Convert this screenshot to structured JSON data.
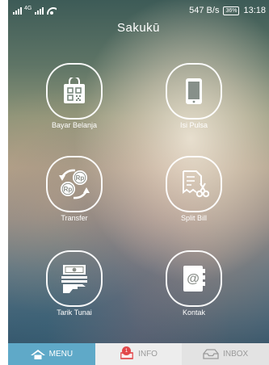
{
  "status_bar": {
    "network_1": "4G",
    "speed": "547 B/s",
    "battery": "36%",
    "time": "13:18"
  },
  "app": {
    "title": "Sakukū"
  },
  "menu": {
    "items": [
      {
        "label": "Bayar Belanja",
        "icon": "shopping-bag-qr-icon"
      },
      {
        "label": "Isi Pulsa",
        "icon": "mobile-phone-icon"
      },
      {
        "label": "Transfer",
        "icon": "money-transfer-icon"
      },
      {
        "label": "Split Bill",
        "icon": "split-bill-scissors-icon"
      },
      {
        "label": "Tarik Tunai",
        "icon": "cash-withdrawal-icon"
      },
      {
        "label": "Kontak",
        "icon": "address-book-icon"
      }
    ]
  },
  "tabs": [
    {
      "label": "MENU",
      "icon": "home-icon",
      "active": true
    },
    {
      "label": "INFO",
      "icon": "info-icon",
      "badge": "1"
    },
    {
      "label": "INBOX",
      "icon": "inbox-icon"
    }
  ],
  "colors": {
    "tab_active": "#5fa9c8",
    "tab_bar": "#e6e6e6",
    "badge": "#e2474a",
    "text_light": "#ffffff"
  }
}
